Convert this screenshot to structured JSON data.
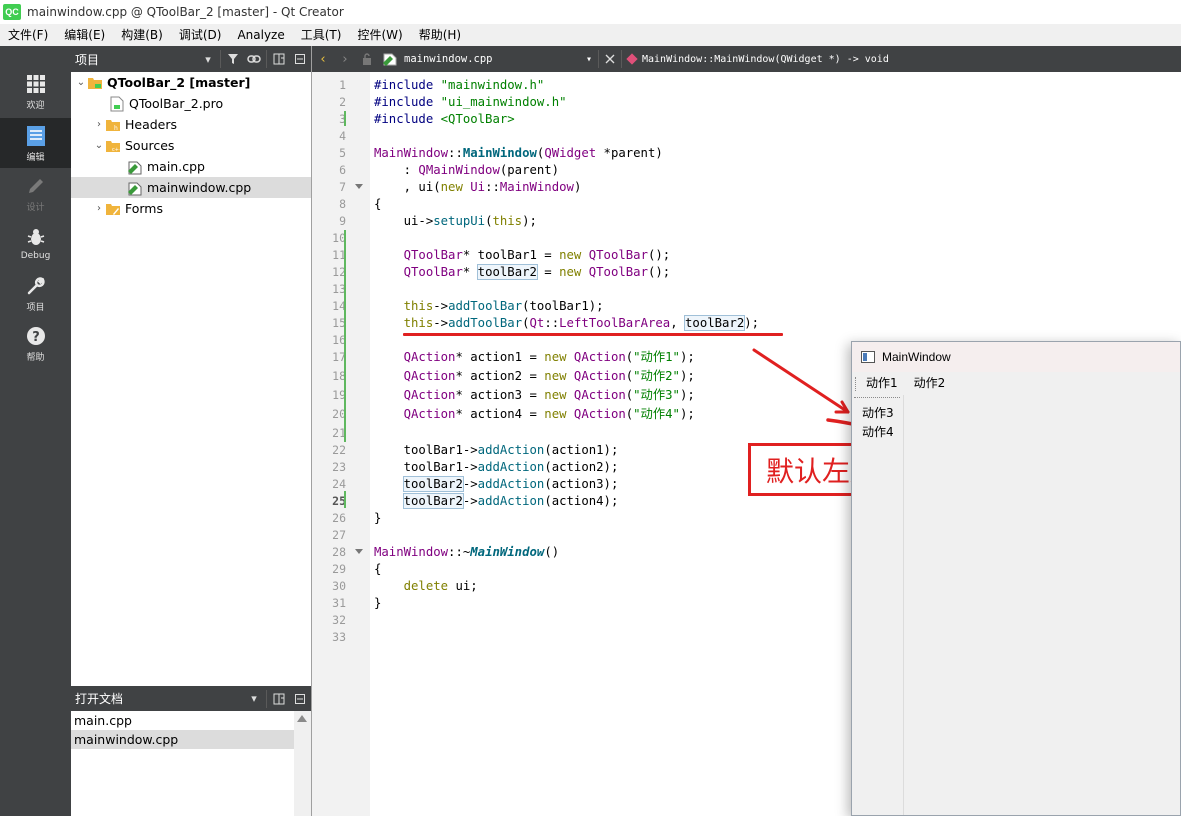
{
  "window": {
    "title": "mainwindow.cpp @ QToolBar_2 [master] - Qt Creator",
    "logo": "QC"
  },
  "menu": [
    "文件(F)",
    "编辑(E)",
    "构建(B)",
    "调试(D)",
    "Analyze",
    "工具(T)",
    "控件(W)",
    "帮助(H)"
  ],
  "modes": {
    "welcome": "欢迎",
    "edit": "编辑",
    "design": "设计",
    "debug": "Debug",
    "projects": "项目",
    "help": "帮助"
  },
  "projects_pane": {
    "title": "项目",
    "root": "QToolBar_2 [master]",
    "pro_file": "QToolBar_2.pro",
    "headers": "Headers",
    "sources": "Sources",
    "main_cpp": "main.cpp",
    "mainwindow_cpp": "mainwindow.cpp",
    "forms": "Forms"
  },
  "open_docs": {
    "title": "打开文档",
    "items": [
      "main.cpp",
      "mainwindow.cpp"
    ]
  },
  "editor": {
    "file": "mainwindow.cpp",
    "symbol": "MainWindow::MainWindow(QWidget *) -> void",
    "line_numbers": [
      "1",
      "2",
      "3",
      "4",
      "5",
      "6",
      "7",
      "8",
      "9",
      "10",
      "11",
      "12",
      "13",
      "14",
      "15",
      "16",
      "17",
      "18",
      "19",
      "20",
      "21",
      "22",
      "23",
      "24",
      "25",
      "26",
      "27",
      "28",
      "29",
      "30",
      "31",
      "32",
      "33"
    ],
    "code": {
      "inc1_kw": "#include ",
      "inc1_str": "\"mainwindow.h\"",
      "inc2_kw": "#include ",
      "inc2_str": "\"ui_mainwindow.h\"",
      "inc3_kw": "#include ",
      "inc3_str": "<QToolBar>",
      "ctor_cls": "MainWindow",
      "ctor_sep": "::",
      "ctor_fn": "MainWindow",
      "ctor_p1": "(",
      "ctor_type": "QWidget",
      "ctor_rest": " *parent)",
      "init1_a": "    : ",
      "init1_cls": "QMainWindow",
      "init1_b": "(parent)",
      "init2_a": "    , ui(",
      "init2_kw": "new",
      "init2_sp": " ",
      "init2_cls": "Ui",
      "init2_sep": "::",
      "init2_cls2": "MainWindow",
      "init2_b": ")",
      "brace_open": "{",
      "setup_a": "    ui->",
      "setup_fn": "setupUi",
      "setup_p": "(",
      "setup_kw": "this",
      "setup_b": ");",
      "tb1_ind": "    ",
      "tb1_cls": "QToolBar",
      "tb1_a": "* ",
      "tb1_var": "toolBar1",
      "tb1_b": " = ",
      "tb1_kw": "new",
      "tb1_sp": " ",
      "tb1_cls2": "QToolBar",
      "tb1_c": "();",
      "tb2_ind": "    ",
      "tb2_cls": "QToolBar",
      "tb2_a": "* ",
      "tb2_var": "toolBar2",
      "tb2_b": " = ",
      "tb2_kw": "new",
      "tb2_sp": " ",
      "tb2_cls2": "QToolBar",
      "tb2_c": "();",
      "add1_ind": "    ",
      "add1_kw": "this",
      "add1_a": "->",
      "add1_fn": "addToolBar",
      "add1_b": "(toolBar1);",
      "add2_ind": "    ",
      "add2_kw": "this",
      "add2_a": "->",
      "add2_fn": "addToolBar",
      "add2_p": "(",
      "add2_cls": "Qt",
      "add2_sep": "::",
      "add2_enum": "LeftToolBarArea",
      "add2_comma": ", ",
      "add2_var": "toolBar2",
      "add2_c": ");",
      "act1_ind": "    ",
      "act1_cls": "QAction",
      "act1_a": "* action1 = ",
      "act1_kw": "new",
      "act1_sp": " ",
      "act1_cls2": "QAction",
      "act1_p": "(",
      "act1_str": "\"动作1\"",
      "act1_c": ");",
      "act2_ind": "    ",
      "act2_cls": "QAction",
      "act2_a": "* action2 = ",
      "act2_kw": "new",
      "act2_sp": " ",
      "act2_cls2": "QAction",
      "act2_p": "(",
      "act2_str": "\"动作2\"",
      "act2_c": ");",
      "act3_ind": "    ",
      "act3_cls": "QAction",
      "act3_a": "* action3 = ",
      "act3_kw": "new",
      "act3_sp": " ",
      "act3_cls2": "QAction",
      "act3_p": "(",
      "act3_str": "\"动作3\"",
      "act3_c": ");",
      "act4_ind": "    ",
      "act4_cls": "QAction",
      "act4_a": "* action4 = ",
      "act4_kw": "new",
      "act4_sp": " ",
      "act4_cls2": "QAction",
      "act4_p": "(",
      "act4_str": "\"动作4\"",
      "act4_c": ");",
      "aa1_ind": "    ",
      "aa1_var": "toolBar1",
      "aa1_a": "->",
      "aa1_fn": "addAction",
      "aa1_b": "(action1);",
      "aa2_ind": "    ",
      "aa2_var": "toolBar1",
      "aa2_a": "->",
      "aa2_fn": "addAction",
      "aa2_b": "(action2);",
      "aa3_ind": "    ",
      "aa3_var": "toolBar2",
      "aa3_a": "->",
      "aa3_fn": "addAction",
      "aa3_b": "(action3);",
      "aa4_ind": "    ",
      "aa4_var": "toolBar2",
      "aa4_a": "->",
      "aa4_fn": "addAction",
      "aa4_b": "(action4);",
      "brace_close": "}",
      "dtor_cls": "MainWindow",
      "dtor_sep": "::~",
      "dtor_fn": "MainWindow",
      "dtor_b": "()",
      "brace_open2": "{",
      "del_ind": "    ",
      "del_kw": "delete",
      "del_b": " ui;",
      "brace_close2": "}"
    }
  },
  "annotation": {
    "text": "默认左边",
    "color": "#e02020"
  },
  "main_window": {
    "title": "MainWindow",
    "top_actions": [
      "动作1",
      "动作2"
    ],
    "left_actions": [
      "动作3",
      "动作4"
    ]
  }
}
